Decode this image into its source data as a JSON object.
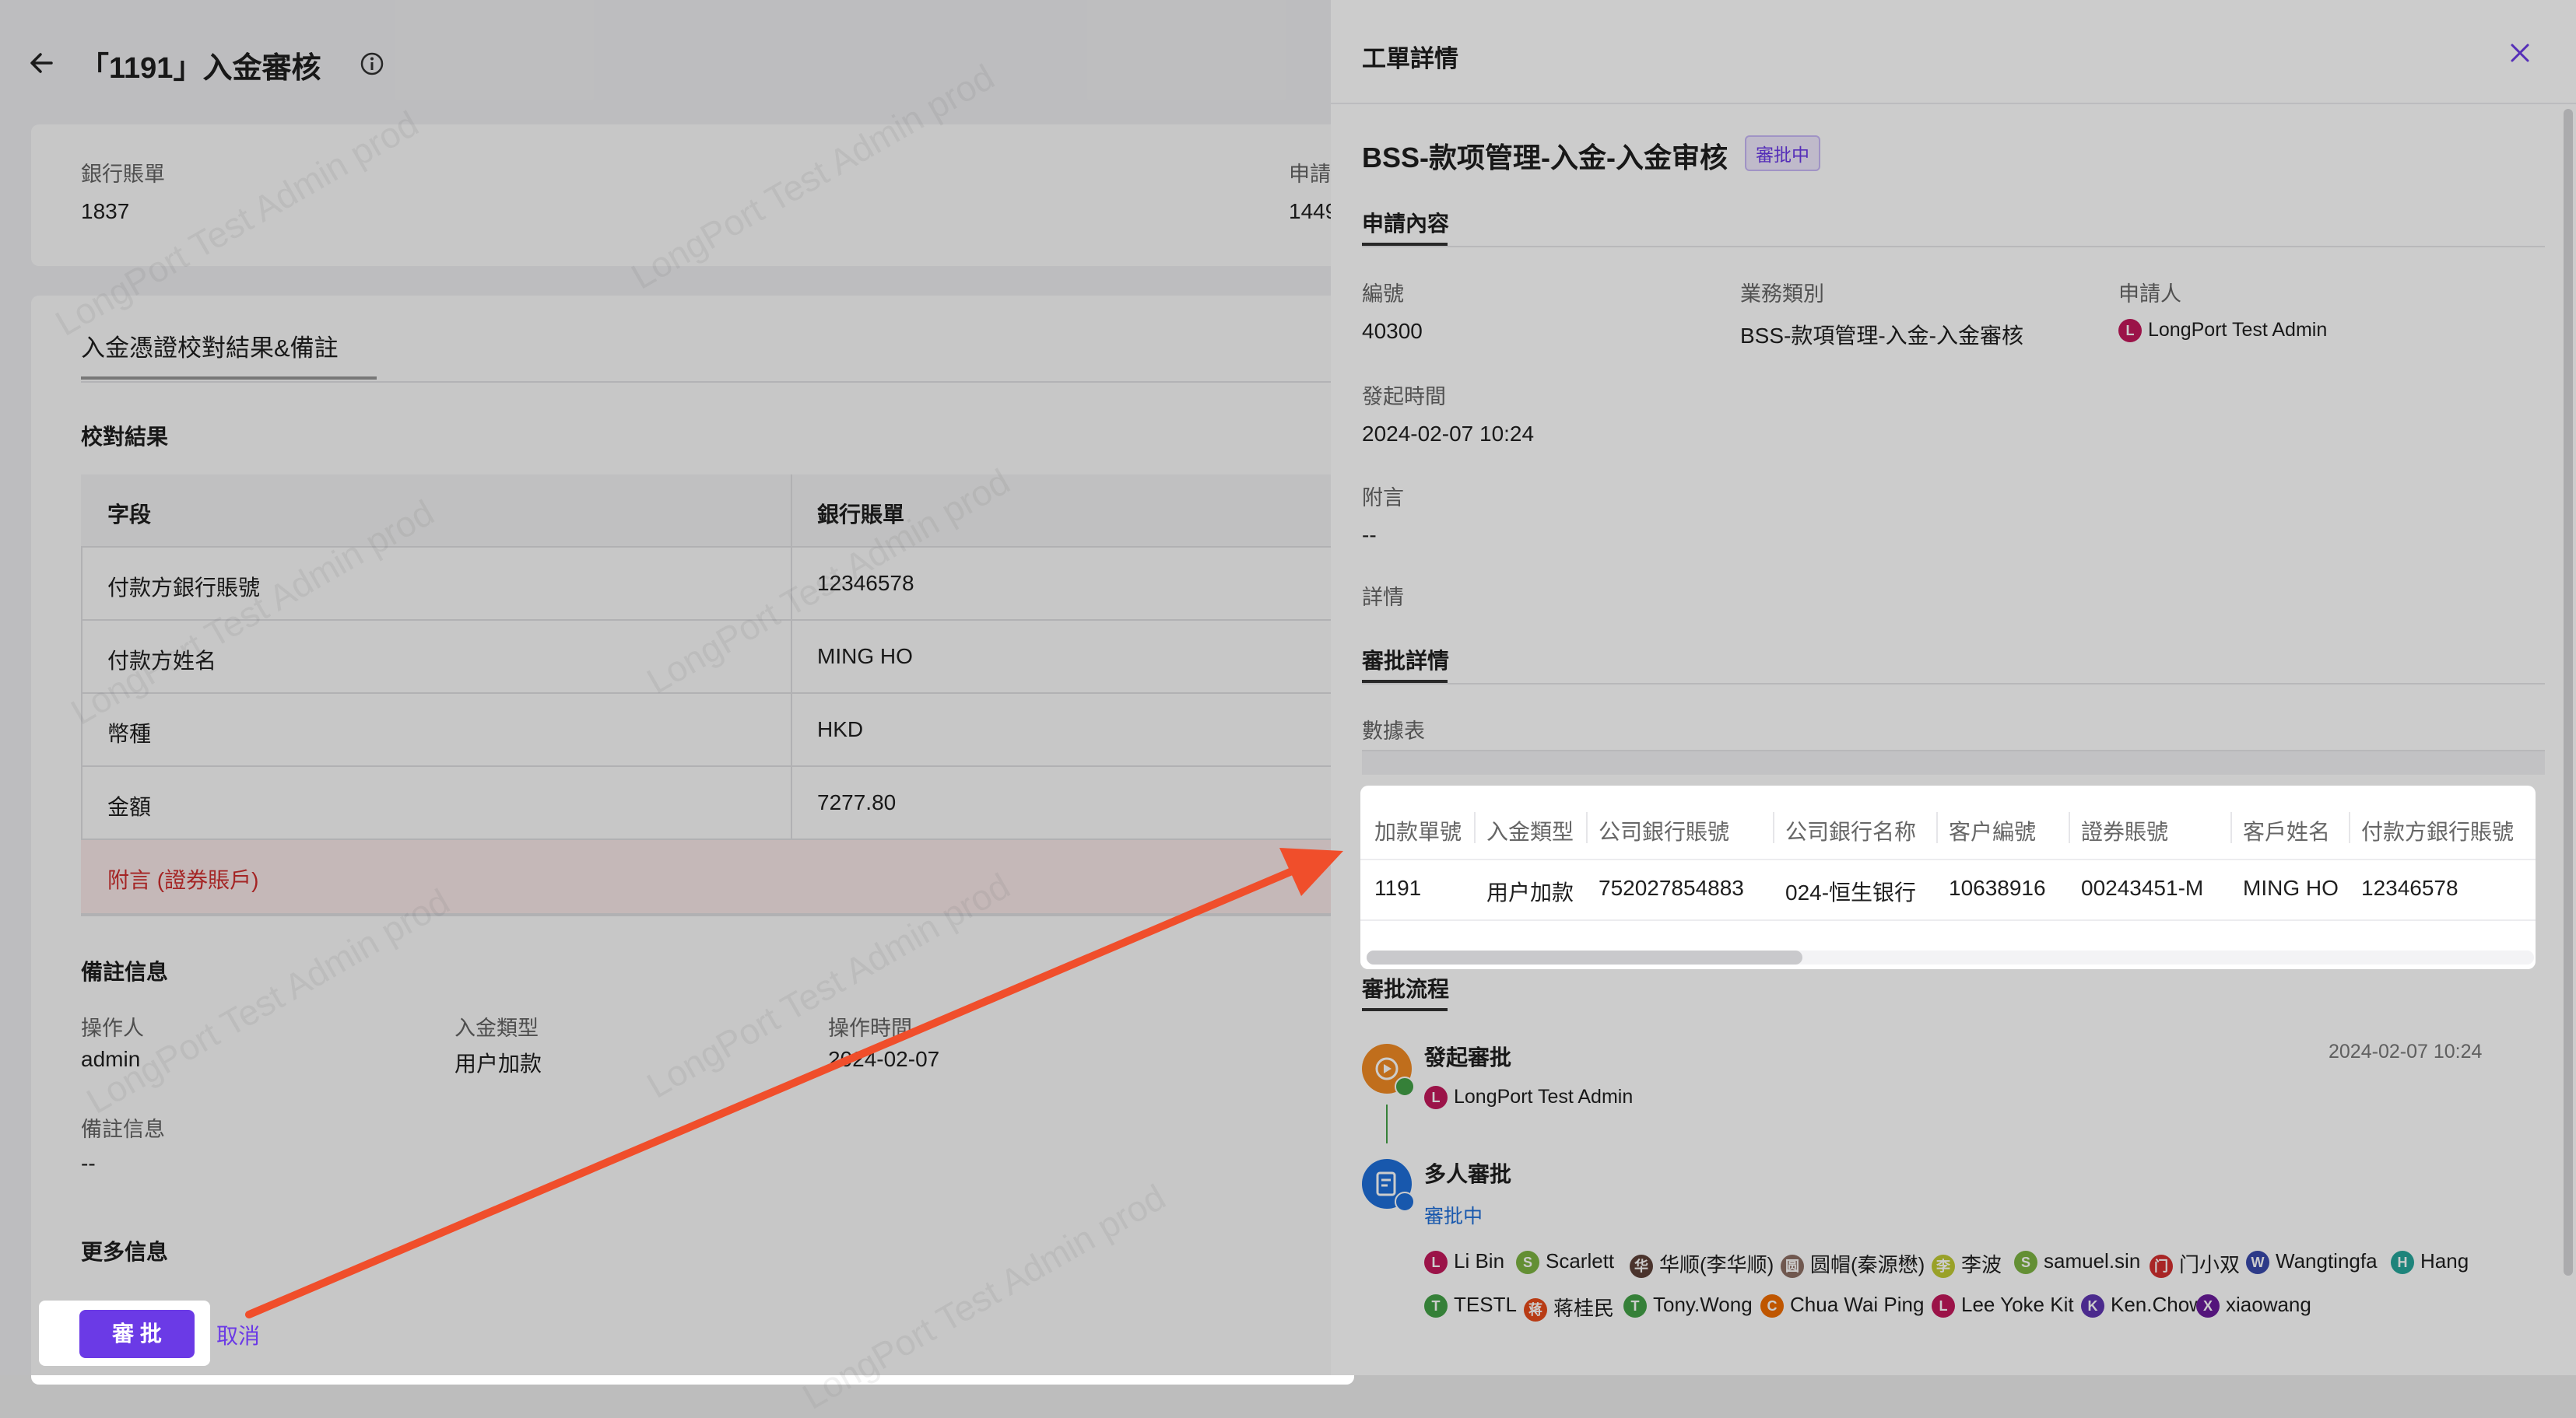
{
  "page": {
    "title": "「1191」入金審核",
    "info_icon": "info-circle-icon",
    "back_icon": "arrow-left-icon"
  },
  "summary": {
    "bank_statement_label": "銀行賬單",
    "bank_statement_value": "1837",
    "applicant_label": "申請",
    "applicant_value": "1449"
  },
  "voucher_section": {
    "tab": "入金憑證校對結果&備註",
    "check_heading": "校對結果",
    "columns": [
      "字段",
      "銀行賬單"
    ],
    "rows": [
      {
        "field": "付款方銀行賬號",
        "value": "12346578"
      },
      {
        "field": "付款方姓名",
        "value": "MING HO"
      },
      {
        "field": "幣種",
        "value": "HKD"
      },
      {
        "field": "金額",
        "value": "7277.80"
      },
      {
        "field": "附言 (證券賬戶)",
        "value": ""
      }
    ],
    "remark_heading": "備註信息",
    "operator_label": "操作人",
    "operator_value": "admin",
    "deposit_type_label": "入金類型",
    "deposit_type_value": "用户加款",
    "op_time_label": "操作時間",
    "op_time_value": "2024-02-07",
    "remark_label": "備註信息",
    "remark_value": "--",
    "more_heading": "更多信息"
  },
  "actions": {
    "approve": "審 批",
    "cancel": "取消"
  },
  "watermark": "LongPort Test Admin prod",
  "drawer": {
    "title": "工單詳情",
    "close_icon": "close-icon",
    "ticket_title": "BSS-款项管理-入金-入金审核",
    "status_badge": "審批中",
    "apply_content_heading": "申請內容",
    "number_label": "編號",
    "number_value": "40300",
    "biz_type_label": "業務類別",
    "biz_type_value": "BSS-款項管理-入金-入金審核",
    "applicant_label": "申請人",
    "applicant_value": "LongPort Test Admin",
    "start_time_label": "發起時間",
    "start_time_value": "2024-02-07 10:24",
    "note_label": "附言",
    "note_value": "--",
    "detail_label": "詳情",
    "approval_detail_heading": "審批詳情",
    "data_table_label": "數據表",
    "data_table": {
      "columns": [
        "加款單號",
        "入金類型",
        "公司銀行賬號",
        "公司銀行名称",
        "客户編號",
        "證券賬號",
        "客戶姓名",
        "付款方銀行賬號"
      ],
      "row": [
        "1191",
        "用户加款",
        "752027854883",
        "024-恒生银行",
        "10638916",
        "00243451-M",
        "MING HO",
        "12346578"
      ]
    },
    "flow_heading": "審批流程",
    "flow": [
      {
        "title": "發起審批",
        "time": "2024-02-07 10:24",
        "person": "LongPort Test Admin"
      },
      {
        "title": "多人審批",
        "status": "審批中"
      }
    ],
    "approvers_line1": [
      {
        "name": "Li Bin",
        "letter": "L",
        "color": "#c2185b"
      },
      {
        "name": "Scarlett",
        "letter": "S",
        "color": "#7cb342"
      },
      {
        "name": "华顺(李华顺)",
        "letter": "华",
        "color": "#5d4037"
      },
      {
        "name": "圆帽(秦源懋)",
        "letter": "圆",
        "color": "#8d6e63"
      },
      {
        "name": "李波",
        "letter": "李",
        "color": "#c0ca33"
      },
      {
        "name": "samuel.sin",
        "letter": "S",
        "color": "#7cb342"
      },
      {
        "name": "门小双",
        "letter": "门",
        "color": "#d32f2f"
      },
      {
        "name": "Wangtingfa",
        "letter": "W",
        "color": "#3949ab"
      },
      {
        "name": "Hang",
        "letter": "H",
        "color": "#26a69a"
      }
    ],
    "approvers_line2": [
      {
        "name": "TESTL",
        "letter": "T",
        "color": "#43a047"
      },
      {
        "name": "蒋桂民",
        "letter": "蒋",
        "color": "#e64a19"
      },
      {
        "name": "Tony.Wong",
        "letter": "T",
        "color": "#43a047"
      },
      {
        "name": "Chua Wai Ping",
        "letter": "C",
        "color": "#ef6c00"
      },
      {
        "name": "Lee Yoke Kit",
        "letter": "L",
        "color": "#c2185b"
      },
      {
        "name": "Ken.Chow",
        "letter": "K",
        "color": "#5e35b1"
      },
      {
        "name": "xiaowang",
        "letter": "X",
        "color": "#6a1b9a"
      }
    ]
  },
  "colors": {
    "primary": "#6b3ae6",
    "danger_text": "#d32f2f",
    "danger_bg": "#fdecec",
    "arrow": "#f04e2b"
  }
}
